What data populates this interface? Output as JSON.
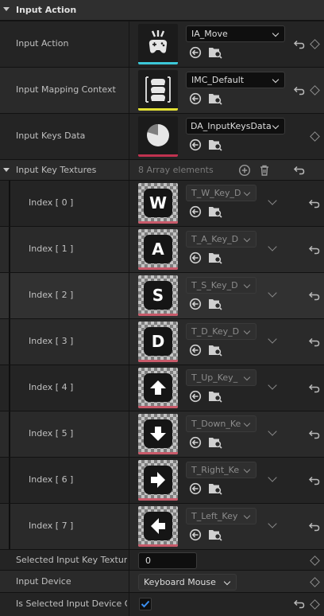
{
  "section": {
    "title": "Input Action"
  },
  "input_action": {
    "label": "Input Action",
    "value": "IA_Move",
    "thumb_bar_color": "#3cc8d8",
    "thumb_icon": "gamepad-icon"
  },
  "mapping_context": {
    "label": "Input Mapping Context",
    "value": "IMC_Default",
    "thumb_bar_color": "#e3e034",
    "thumb_icon": "stacked-gamepads-icon"
  },
  "keys_data": {
    "label": "Input Keys Data",
    "value": "DA_InputKeysData",
    "thumb_bar_color": "#c0324f",
    "thumb_icon": "pie-chart-icon"
  },
  "textures": {
    "label": "Input Key Textures",
    "count_text": "8 Array elements",
    "texture_bar_color": "#c85a6a",
    "items": [
      {
        "index": "Index [ 0 ]",
        "asset": "T_W_Key_D",
        "glyph": "W"
      },
      {
        "index": "Index [ 1 ]",
        "asset": "T_A_Key_D",
        "glyph": "A"
      },
      {
        "index": "Index [ 2 ]",
        "asset": "T_S_Key_D",
        "glyph": "S"
      },
      {
        "index": "Index [ 3 ]",
        "asset": "T_D_Key_D",
        "glyph": "D"
      },
      {
        "index": "Index [ 4 ]",
        "asset": "T_Up_Key_",
        "glyph": "up-arrow-icon"
      },
      {
        "index": "Index [ 5 ]",
        "asset": "T_Down_Ke",
        "glyph": "down-arrow-icon"
      },
      {
        "index": "Index [ 6 ]",
        "asset": "T_Right_Ke",
        "glyph": "right-arrow-icon"
      },
      {
        "index": "Index [ 7 ]",
        "asset": "T_Left_Key",
        "glyph": "left-arrow-icon"
      }
    ]
  },
  "selected_key_texture": {
    "label": "Selected Input Key Textur…",
    "value": "0"
  },
  "input_device": {
    "label": "Input Device",
    "value": "Keyboard Mouse"
  },
  "selected_device": {
    "label": "Is Selected Input Device O…",
    "checked": true
  }
}
